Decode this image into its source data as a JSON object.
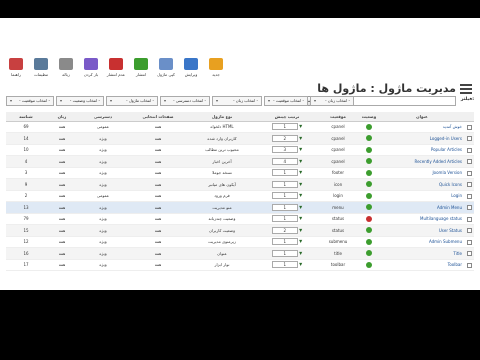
{
  "page": {
    "title": "مدیریت ماژول : ماژول ها"
  },
  "toolbar": {
    "buttons": [
      {
        "id": "new",
        "label": "جدید",
        "color": "#e8a020",
        "icon": "star-icon"
      },
      {
        "id": "edit",
        "label": "ویرایش",
        "color": "#3a76c8",
        "icon": "edit-icon"
      },
      {
        "id": "copy",
        "label": "کپی ماژول",
        "color": "#6a8fc8",
        "icon": "copy-icon"
      },
      {
        "id": "publish",
        "label": "انتشار",
        "color": "#3c9d2e",
        "icon": "check-icon"
      },
      {
        "id": "unpublish",
        "label": "عدم انتشار",
        "color": "#c83030",
        "icon": "cross-icon"
      },
      {
        "id": "checkin",
        "label": "باز کردن",
        "color": "#7a5ac8",
        "icon": "checkin-icon"
      },
      {
        "id": "trash",
        "label": "زباله",
        "color": "#8a8a8a",
        "icon": "trash-icon"
      },
      {
        "id": "options",
        "label": "تنظیمات",
        "color": "#5a7a9a",
        "icon": "options-icon"
      },
      {
        "id": "help",
        "label": "راهنما",
        "color": "#c84040",
        "icon": "help-icon"
      }
    ]
  },
  "filter": {
    "label": "فیلتر:",
    "input_value": "",
    "search_label": "جستجو",
    "clear_label": "پاکسازی",
    "selects": [
      "- انتخاب موقعیت -",
      "- انتخاب وضعیت -",
      "- انتخاب ماژول -",
      "- انتخاب دسترسی -",
      "- انتخاب زبان -",
      "- انتخاب موقعیت -",
      "- انتخاب زبان -",
      "براساس موقعیت ماژول",
      "مدیریت کل"
    ]
  },
  "grid": {
    "headers": [
      "",
      "عنوان",
      "وضعیت",
      "موقعیت",
      "ترتیب چینش",
      "نوع ماژول",
      "صفحات انتخابی",
      "دسترسی",
      "زبان",
      "شناسه"
    ],
    "rows": [
      {
        "title": "خوش آمدید",
        "on": true,
        "pos": "cpanel",
        "order": "1",
        "type": "HTML دلخواه",
        "pages": "همه",
        "access": "عمومی",
        "lang": "همه",
        "id": "69"
      },
      {
        "title": "Logged-in Users",
        "on": true,
        "pos": "cpanel",
        "order": "2",
        "type": "کاربران وارد شده",
        "pages": "همه",
        "access": "ویژه",
        "lang": "همه",
        "id": "14"
      },
      {
        "title": "Popular Articles",
        "on": true,
        "pos": "cpanel",
        "order": "3",
        "type": "محبوب ترین مطالب",
        "pages": "همه",
        "access": "ویژه",
        "lang": "همه",
        "id": "10"
      },
      {
        "title": "Recently Added Articles",
        "on": true,
        "pos": "cpanel",
        "order": "4",
        "type": "آخرین اخبار",
        "pages": "همه",
        "access": "ویژه",
        "lang": "همه",
        "id": "4"
      },
      {
        "title": "Joomla Version",
        "on": true,
        "pos": "footer",
        "order": "1",
        "type": "نسخه جوملا",
        "pages": "همه",
        "access": "ویژه",
        "lang": "همه",
        "id": "3"
      },
      {
        "title": "Quick Icons",
        "on": true,
        "pos": "icon",
        "order": "1",
        "type": "آیکون های میانبر",
        "pages": "همه",
        "access": "ویژه",
        "lang": "همه",
        "id": "9"
      },
      {
        "title": "Login",
        "on": true,
        "pos": "login",
        "order": "1",
        "type": "فرم ورود",
        "pages": "همه",
        "access": "عمومی",
        "lang": "همه",
        "id": "2"
      },
      {
        "title": "Admin Menu",
        "on": true,
        "pos": "menu",
        "order": "1",
        "type": "منو مدیریت",
        "pages": "همه",
        "access": "ویژه",
        "lang": "همه",
        "id": "13"
      },
      {
        "title": "Multilanguage status",
        "on": false,
        "pos": "status",
        "order": "1",
        "type": "وضعیت چندزبانه",
        "pages": "همه",
        "access": "ویژه",
        "lang": "همه",
        "id": "79"
      },
      {
        "title": "User Status",
        "on": true,
        "pos": "status",
        "order": "2",
        "type": "وضعیت کاربران",
        "pages": "همه",
        "access": "ویژه",
        "lang": "همه",
        "id": "15"
      },
      {
        "title": "Admin Submenu",
        "on": true,
        "pos": "submenu",
        "order": "1",
        "type": "زیرمنوی مدیریت",
        "pages": "همه",
        "access": "ویژه",
        "lang": "همه",
        "id": "12"
      },
      {
        "title": "Title",
        "on": true,
        "pos": "title",
        "order": "1",
        "type": "عنوان",
        "pages": "همه",
        "access": "ویژه",
        "lang": "همه",
        "id": "16"
      },
      {
        "title": "Toolbar",
        "on": true,
        "pos": "toolbar",
        "order": "1",
        "type": "نوار ابزار",
        "pages": "همه",
        "access": "ویژه",
        "lang": "همه",
        "id": "17"
      }
    ]
  }
}
